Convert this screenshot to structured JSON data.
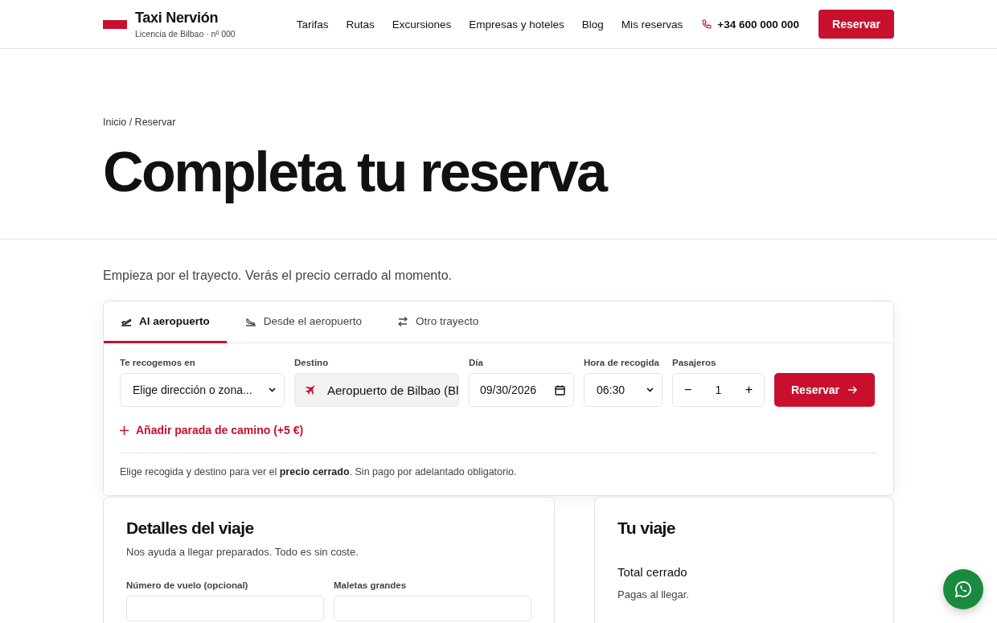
{
  "header": {
    "brand": "Taxi Nervión",
    "license": "Licencia de Bilbao · nº 000",
    "nav": [
      "Tarifas",
      "Rutas",
      "Excursiones",
      "Empresas y hoteles",
      "Blog",
      "Mis reservas"
    ],
    "phone": "+34 600 000 000",
    "cta": "Reservar"
  },
  "hero": {
    "breadcrumb": "Inicio / Reservar",
    "title": "Completa tu reserva"
  },
  "booking": {
    "intro": "Empieza por el trayecto. Verás el precio cerrado al momento.",
    "tabs": [
      {
        "label": "Al aeropuerto",
        "kind": "departure",
        "selected": true
      },
      {
        "label": "Desde el aeropuerto",
        "kind": "arrival",
        "selected": false
      },
      {
        "label": "Otro trayecto",
        "kind": "swap",
        "selected": false
      }
    ],
    "fields": [
      {
        "kind": "select",
        "label": "Te recogemos en",
        "value": "Elige dirección o zona..."
      },
      {
        "kind": "fixed",
        "label": "Destino",
        "value": "Aeropuerto de Bilbao (Bl"
      },
      {
        "kind": "date",
        "label": "Día",
        "value": "09/30/2026"
      },
      {
        "kind": "select",
        "label": "Hora de recogida",
        "value": "06:30"
      },
      {
        "kind": "stepper",
        "label": "Pasajeros",
        "value": "1",
        "minus": "−",
        "plus": "+"
      }
    ],
    "submit": "Reservar",
    "add_stop": "Añadir parada de camino (+5 €)",
    "note": "Elige recogida y destino para ver el **precio cerrado**. Sin pago por adelantado obligatorio."
  },
  "details": {
    "title": "Detalles del viaje",
    "subtitle": "Nos ayuda a llegar preparados. Todo es sin coste.",
    "fields": [
      "Número de vuelo (opcional)",
      "Maletas grandes"
    ]
  },
  "summary": {
    "title": "Tu viaje",
    "total_label": "Total cerrado",
    "pay_note": "Pagas al llegar."
  }
}
